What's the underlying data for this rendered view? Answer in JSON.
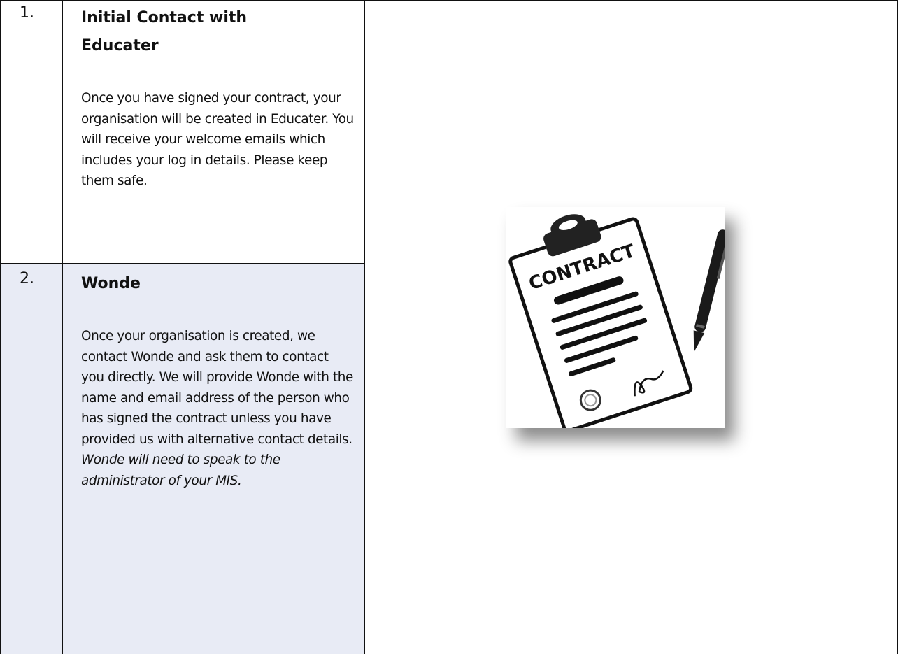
{
  "steps": [
    {
      "number": "1.",
      "title": "Initial Contact with Educater",
      "body": "Once you have signed your contract, your organisation will be created in Educater. You will receive your welcome emails which includes your log in details. Please keep them safe."
    },
    {
      "number": "2.",
      "title": "Wonde",
      "body": "Once your organisation is created, we contact Wonde and ask them to contact you directly. We will provide Wonde with the name and email address of the person who has signed the contract unless you have provided us with alternative contact details.",
      "note": "Wonde will need to speak to the administrator of your MIS."
    }
  ],
  "illustration": {
    "icon": "contract-clipboard-pen-icon",
    "word": "CONTRACT"
  },
  "colors": {
    "shaded_row": "#e8ebf5",
    "border": "#111111"
  }
}
